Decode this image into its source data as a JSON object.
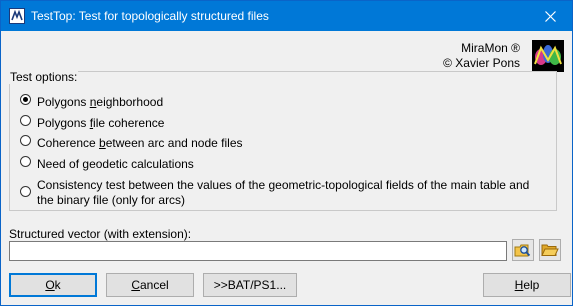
{
  "window": {
    "title": "TestTop: Test for topologically structured files"
  },
  "brand": {
    "product": "MiraMon ®",
    "author": "© Xavier Pons"
  },
  "options": {
    "legend": "Test options:",
    "items": [
      {
        "pre": "Polygons ",
        "accel": "n",
        "post": "eighborhood",
        "checked": true
      },
      {
        "pre": "Polygons ",
        "accel": "f",
        "post": "ile coherence",
        "checked": false
      },
      {
        "pre": "Coherence ",
        "accel": "b",
        "post": "etween arc and node files",
        "checked": false
      },
      {
        "pre": "Need of ",
        "accel": "g",
        "post": "eodetic calculations",
        "checked": false
      },
      {
        "pre": "Consistency test between the values of the geometric-topological fields of the main table and the binary file (only for arcs)",
        "accel": "",
        "post": "",
        "checked": false
      }
    ]
  },
  "vector": {
    "label": "Structured vector (with extension):",
    "value": ""
  },
  "buttons": {
    "ok": {
      "accel": "O",
      "rest": "k"
    },
    "cancel": {
      "accel": "C",
      "rest": "ancel"
    },
    "bat": ">>BAT/PS1...",
    "help": {
      "accel": "H",
      "rest": "elp"
    }
  },
  "colors": {
    "titlebar": "#0078d7",
    "dialog_bg": "#f0f0f0"
  }
}
